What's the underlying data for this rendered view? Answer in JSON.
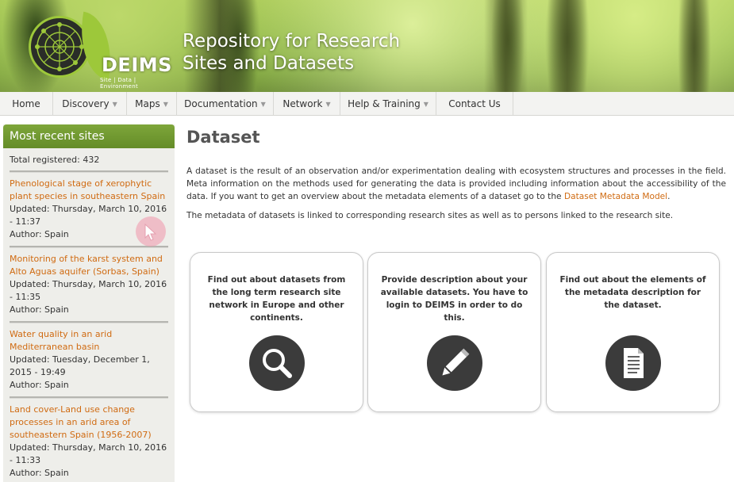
{
  "header": {
    "logo_text": "DEIMS",
    "logo_sub": "Site | Data | Environment",
    "title_line1": "Repository for Research",
    "title_line2": "Sites and Datasets"
  },
  "nav": {
    "items": [
      {
        "label": "Home"
      },
      {
        "label": "Discovery"
      },
      {
        "label": "Maps"
      },
      {
        "label": "Documentation"
      },
      {
        "label": "Network"
      },
      {
        "label": "Help & Training"
      },
      {
        "label": "Contact Us"
      }
    ],
    "caret": "▼"
  },
  "sidebar": {
    "heading": "Most recent sites",
    "total": "Total registered: 432",
    "sites": [
      {
        "title": "Phenological stage of xerophytic plant species in southeastern Spain",
        "updated": "Updated: Thursday, March 10, 2016 - 11:37",
        "author": "Author: Spain"
      },
      {
        "title": "Monitoring of the karst system and Alto Aguas aquifer (Sorbas, Spain)",
        "updated": "Updated: Thursday, March 10, 2016 - 11:35",
        "author": "Author: Spain"
      },
      {
        "title": "Water quality in an arid Mediterranean basin",
        "updated": "Updated: Tuesday, December 1, 2015 - 19:49",
        "author": "Author: Spain"
      },
      {
        "title": "Land cover-Land use change processes in an arid area of southeastern Spain (1956-2007)",
        "updated": "Updated: Thursday, March 10, 2016 - 11:33",
        "author": "Author: Spain"
      }
    ]
  },
  "main": {
    "title": "Dataset",
    "intro_before": "A dataset is the result of an observation and/or experimentation dealing with ecosystem structures and processes in the field. Meta information on the methods used for generating the data is provided including information about the accessibility of the data. If you want to get an overview about the metadata elements of a dataset go to the ",
    "intro_link": "Dataset Metadata Model",
    "intro_after": ".",
    "intro2": "The metadata of datasets is linked to corresponding research sites as well as to persons linked to the research site.",
    "cards": [
      {
        "text": "Find out about datasets from the long term research site network in Europe and other continents.",
        "icon": "search-icon"
      },
      {
        "text": "Provide description about your available datasets. You have to login to DEIMS in order to do this.",
        "icon": "pencil-icon"
      },
      {
        "text": "Find out about the elements of the metadata description for the dataset.",
        "icon": "document-icon"
      }
    ]
  },
  "colors": {
    "accent_green": "#6f9a2f",
    "link_orange": "#d06b12"
  }
}
